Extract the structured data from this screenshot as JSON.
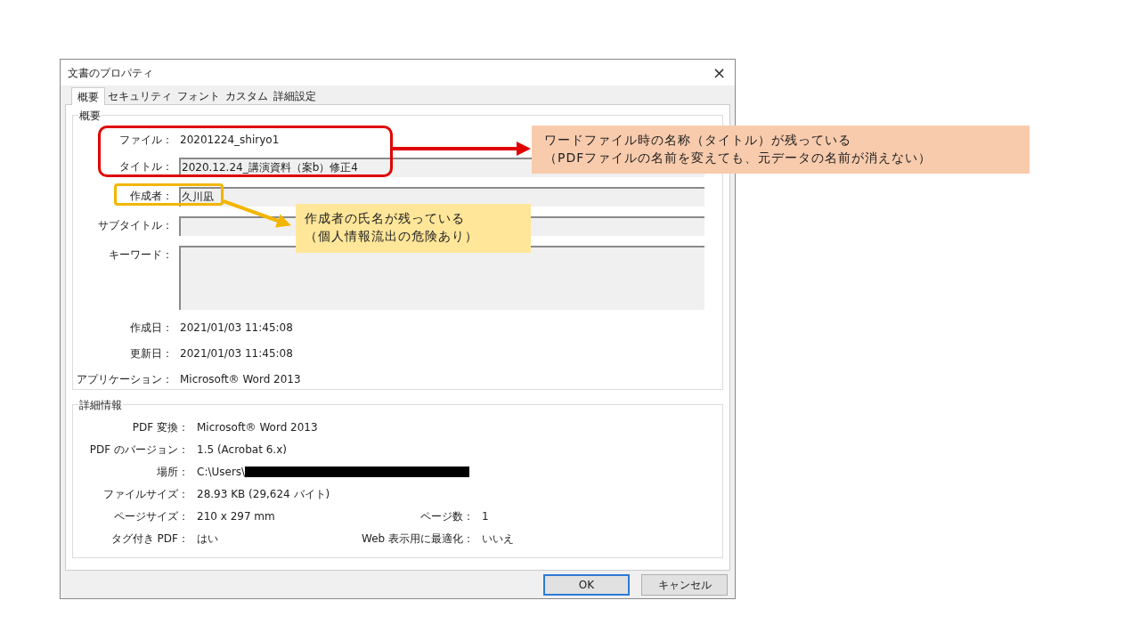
{
  "dialog": {
    "title": "文書のプロパティ",
    "close": "×"
  },
  "tabs": [
    {
      "label": "概要",
      "selected": true
    },
    {
      "label": "セキュリティ",
      "selected": false
    },
    {
      "label": "フォント",
      "selected": false
    },
    {
      "label": "カスタム",
      "selected": false
    },
    {
      "label": "詳細設定",
      "selected": false
    }
  ],
  "summary": {
    "title": "概要",
    "rows": [
      {
        "kind": "text",
        "label": "ファイル：",
        "value": "20201224_shiryo1"
      },
      {
        "kind": "field",
        "label": "タイトル：",
        "value": "2020.12.24_講演資料（案b）修正4"
      },
      {
        "kind": "field",
        "label": "作成者：",
        "value": "久川凪"
      },
      {
        "kind": "field",
        "label": "サブタイトル："
      },
      {
        "kind": "area",
        "label": "キーワード："
      },
      {
        "kind": "text",
        "label": "作成日：",
        "value": "2021/01/03 11:45:08"
      },
      {
        "kind": "text",
        "label": "更新日：",
        "value": "2021/01/03 11:45:08"
      },
      {
        "kind": "text",
        "label": "アプリケーション：",
        "value": "Microsoft® Word 2013"
      }
    ]
  },
  "details": {
    "title": "詳細情報",
    "rows": [
      {
        "label": "PDF 変換：",
        "value": "Microsoft® Word 2013"
      },
      {
        "label": "PDF のバージョン：",
        "value": "1.5 (Acrobat 6.x)"
      },
      {
        "label": "場所：",
        "value": "C:\\Users\\",
        "redacted": true
      },
      {
        "label": "ファイルサイズ：",
        "value": "28.93 KB (29,624 バイト)"
      },
      {
        "label": "ページサイズ：",
        "value": "210 x 297 mm",
        "label_2": "ページ数：",
        "value_2": "1"
      },
      {
        "label": "タグ付き PDF：",
        "value": "はい",
        "label_2": "Web 表示用に最適化：",
        "value_2": "いいえ"
      }
    ]
  },
  "buttons": [
    {
      "label": "OK",
      "default": true
    },
    {
      "label": "キャンセル",
      "default": false
    }
  ],
  "annotations": [
    {
      "kind": "title",
      "color": "#f8cbad",
      "lines": [
        "ワードファイル時の名称（タイトル）が残っている",
        "（PDFファイルの名前を変えても、元データの名前が消えない）"
      ]
    },
    {
      "kind": "author",
      "color": "#ffe699",
      "lines": [
        "作成者の氏名が残っている",
        "（個人情報流出の危険あり）"
      ]
    }
  ]
}
